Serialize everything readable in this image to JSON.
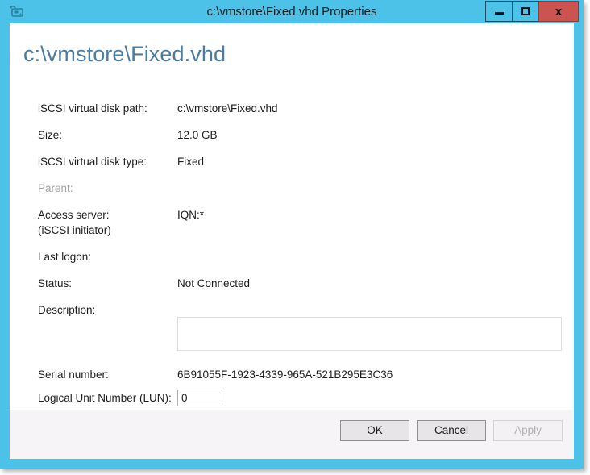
{
  "window": {
    "title": "c:\\vmstore\\Fixed.vhd Properties",
    "icon": "iscsi-virtual-disk-icon",
    "controls": {
      "minimize": "–",
      "maximize": "□",
      "close": "x"
    },
    "frame_color": "#4cc2e8",
    "close_color": "#cb5450"
  },
  "heading": "c:\\vmstore\\Fixed.vhd",
  "heading_color": "#4a7ba0",
  "fields": [
    {
      "label": "iSCSI virtual disk path:",
      "value": "c:\\vmstore\\Fixed.vhd",
      "dim": false
    },
    {
      "label": "Size:",
      "value": "12.0 GB",
      "dim": false
    },
    {
      "label": "iSCSI virtual disk type:",
      "value": "Fixed",
      "dim": false
    },
    {
      "label": "Parent:",
      "value": "",
      "dim": true
    },
    {
      "label": "Access server:",
      "label_line2": "(iSCSI initiator)",
      "value": "IQN:*",
      "dim": false
    },
    {
      "label": "Last logon:",
      "value": "",
      "dim": false
    },
    {
      "label": "Status:",
      "value": "Not Connected",
      "dim": false
    },
    {
      "label": "Description:",
      "value": "",
      "dim": false
    },
    {
      "label": "Serial number:",
      "value": "6B91055F-1923-4339-965A-521B295E3C36",
      "dim": false
    },
    {
      "label": "Logical Unit Number (LUN):",
      "value": "",
      "dim": false
    }
  ],
  "inputs": {
    "description": {
      "value": "",
      "placeholder": ""
    },
    "lun": {
      "value": "0",
      "placeholder": ""
    }
  },
  "footer": {
    "ok_label": "OK",
    "cancel_label": "Cancel",
    "apply_label": "Apply",
    "apply_enabled": false
  }
}
